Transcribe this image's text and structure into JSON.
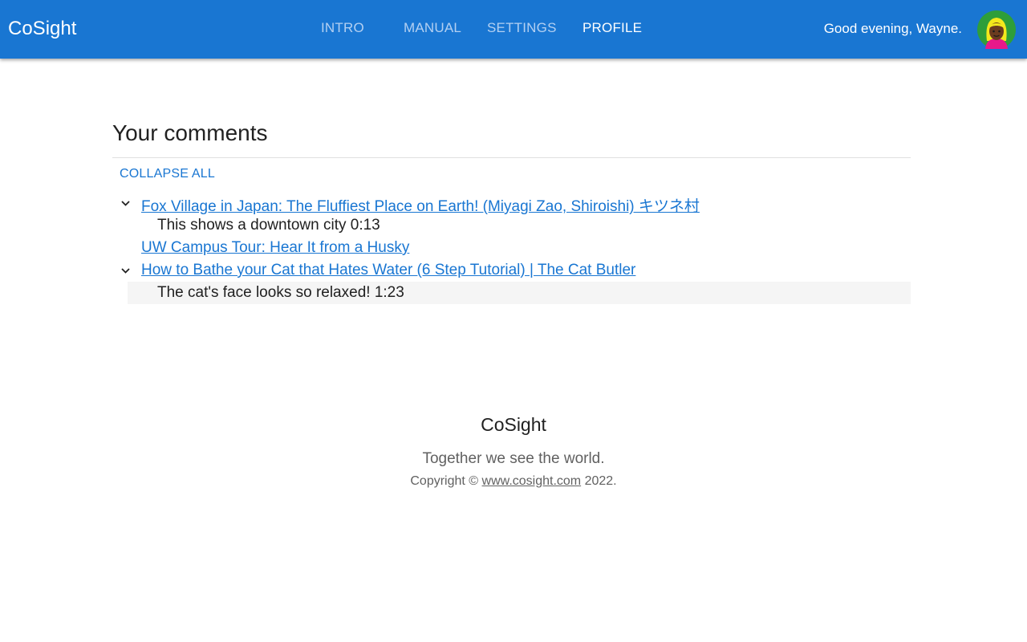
{
  "header": {
    "brand": "CoSight",
    "nav": [
      {
        "label": "INTRO",
        "active": false
      },
      {
        "label": "MANUAL",
        "active": false
      },
      {
        "label": "SETTINGS",
        "active": false
      },
      {
        "label": "PROFILE",
        "active": true
      }
    ],
    "greeting": "Good evening, Wayne.",
    "avatar_icon": "user-avatar-icon"
  },
  "main": {
    "title": "Your comments",
    "collapse_all": "COLLAPSE ALL",
    "videos": [
      {
        "title": "Fox Village in Japan: The Fluffiest Place on Earth! (Miyagi Zao, Shiroishi) キツネ村",
        "expanded": true,
        "comments": [
          {
            "text": "This shows a downtown city 0:13",
            "selected": false
          }
        ]
      },
      {
        "title": "UW Campus Tour: Hear It from a Husky",
        "expanded": false,
        "comments": []
      },
      {
        "title": "How to Bathe your Cat that Hates Water (6 Step Tutorial) | The Cat Butler",
        "expanded": true,
        "comments": [
          {
            "text": "The cat's face looks so relaxed! 1:23",
            "selected": true
          }
        ]
      }
    ]
  },
  "footer": {
    "brand": "CoSight",
    "tagline": "Together we see the world.",
    "copyright_prefix": "Copyright ©",
    "copyright_link": "www.cosight.com",
    "copyright_suffix": "2022."
  },
  "colors": {
    "primary": "#1976d2",
    "nav_inactive": "#b3d0f2",
    "selected_row": "#f5f5f5"
  }
}
